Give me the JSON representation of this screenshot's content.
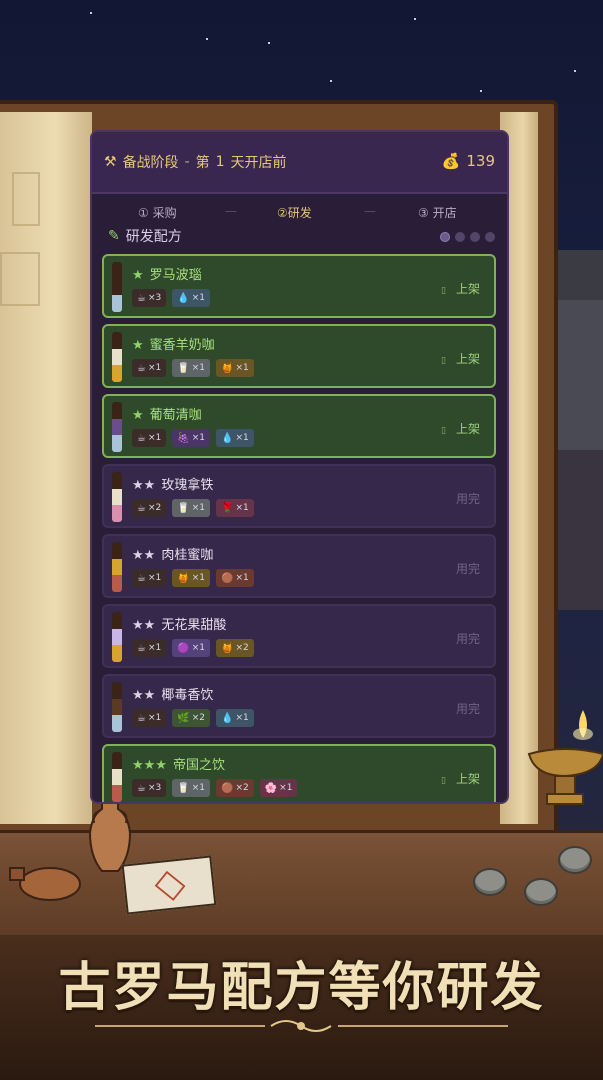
{
  "header": {
    "stage": "备战阶段",
    "separator": "-",
    "day_prefix": "第",
    "day": "1",
    "day_suffix": "天开店前",
    "coins": "139",
    "hammer_icon": "hammer-pick-icon",
    "coin_icon": "money-bag-icon"
  },
  "steps": [
    {
      "label": "① 采购"
    },
    {
      "label": "②研发",
      "active": true
    },
    {
      "label": "③ 开店"
    }
  ],
  "section": {
    "title": "研发配方",
    "icon": "pencil-icon"
  },
  "recipes": [
    {
      "stars": "★",
      "name": "罗马波瑙",
      "status": "上架",
      "on": true,
      "ingredients": [
        {
          "glyph": "☕",
          "text": "×3",
          "color": "#3b2c2a"
        },
        {
          "glyph": "💧",
          "text": "×1",
          "color": "#3d5566"
        }
      ]
    },
    {
      "stars": "★",
      "name": "蜜香羊奶咖",
      "status": "上架",
      "on": true,
      "ingredients": [
        {
          "glyph": "☕",
          "text": "×1",
          "color": "#3b2c2a"
        },
        {
          "glyph": "🥛",
          "text": "×1",
          "color": "#5f6466"
        },
        {
          "glyph": "🍯",
          "text": "×1",
          "color": "#6a5524"
        }
      ]
    },
    {
      "stars": "★",
      "name": "葡萄清咖",
      "status": "上架",
      "on": true,
      "ingredients": [
        {
          "glyph": "☕",
          "text": "×1",
          "color": "#3b2c2a"
        },
        {
          "glyph": "🍇",
          "text": "×1",
          "color": "#4a3566"
        },
        {
          "glyph": "💧",
          "text": "×1",
          "color": "#3d5566"
        }
      ]
    },
    {
      "stars": "★★",
      "name": "玫瑰拿铁",
      "status": "用完",
      "on": false,
      "ingredients": [
        {
          "glyph": "☕",
          "text": "×2",
          "color": "#3b2c2a"
        },
        {
          "glyph": "🥛",
          "text": "×1",
          "color": "#5f6466"
        },
        {
          "glyph": "🌹",
          "text": "×1",
          "color": "#663348"
        }
      ]
    },
    {
      "stars": "★★",
      "name": "肉桂蜜咖",
      "status": "用完",
      "on": false,
      "ingredients": [
        {
          "glyph": "☕",
          "text": "×1",
          "color": "#3b2c2a"
        },
        {
          "glyph": "🍯",
          "text": "×1",
          "color": "#6a5524"
        },
        {
          "glyph": "🟤",
          "text": "×1",
          "color": "#6a3a30"
        }
      ]
    },
    {
      "stars": "★★",
      "name": "无花果甜酸",
      "status": "用完",
      "on": false,
      "ingredients": [
        {
          "glyph": "☕",
          "text": "×1",
          "color": "#3b2c2a"
        },
        {
          "glyph": "🟣",
          "text": "×1",
          "color": "#54437a"
        },
        {
          "glyph": "🍯",
          "text": "×2",
          "color": "#6a5524"
        }
      ]
    },
    {
      "stars": "★★",
      "name": "椰毒香饮",
      "status": "用完",
      "on": false,
      "ingredients": [
        {
          "glyph": "☕",
          "text": "×1",
          "color": "#3b2c2a"
        },
        {
          "glyph": "🌿",
          "text": "×2",
          "color": "#3e5535"
        },
        {
          "glyph": "💧",
          "text": "×1",
          "color": "#3d5566"
        }
      ]
    },
    {
      "stars": "★★★",
      "name": "帝国之饮",
      "status": "上架",
      "on": true,
      "ingredients": [
        {
          "glyph": "☕",
          "text": "×3",
          "color": "#3b2c2a"
        },
        {
          "glyph": "🥛",
          "text": "×1",
          "color": "#5f6466"
        },
        {
          "glyph": "🟤",
          "text": "×2",
          "color": "#6a3a30"
        },
        {
          "glyph": "🌸",
          "text": "×1",
          "color": "#663348"
        }
      ]
    }
  ],
  "bar_colors": [
    [
      "#3a2418",
      "#3a2418",
      "#a9c3d8"
    ],
    [
      "#3a2418",
      "#e8e0c8",
      "#d7a52e"
    ],
    [
      "#3a2418",
      "#6b4d8f",
      "#a9c3d8"
    ],
    [
      "#3a2418",
      "#e8e0c8",
      "#d98fb0"
    ],
    [
      "#3a2418",
      "#d7a52e",
      "#b85b4a"
    ],
    [
      "#3a2418",
      "#c9b6e6",
      "#d7a52e"
    ],
    [
      "#3a2418",
      "#5b3a24",
      "#a9c3d8"
    ],
    [
      "#3a2418",
      "#e8e0c8",
      "#b85b4a"
    ]
  ],
  "banner": "古罗马配方等你研发",
  "colors": {
    "accent_gold": "#e5c77a",
    "unlocked_green": "#7fb05a",
    "panel_bg": "#2a1d37"
  }
}
